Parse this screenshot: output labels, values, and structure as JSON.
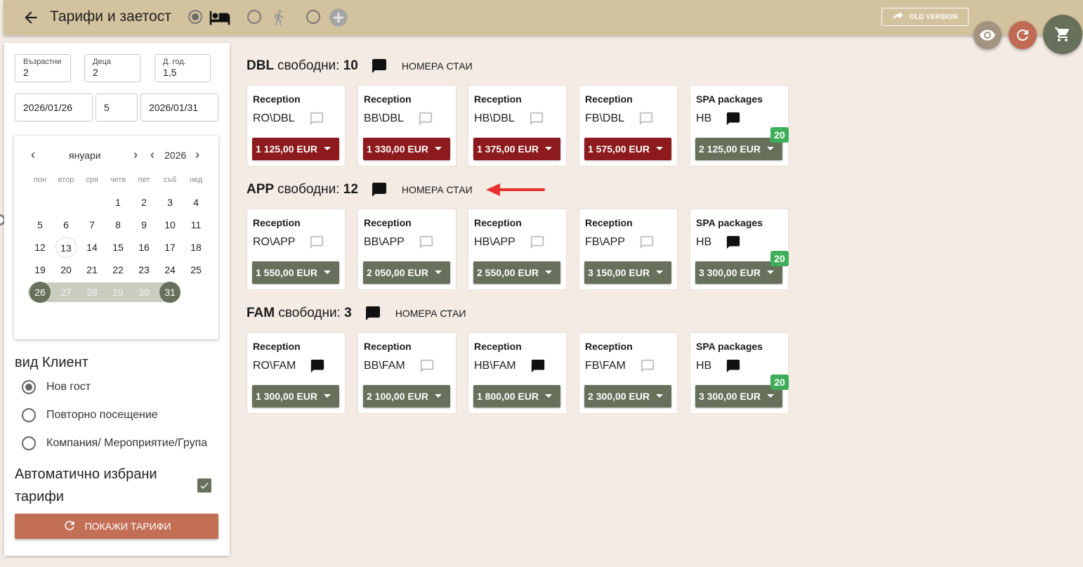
{
  "header": {
    "title": "Тарифи и заетост",
    "old_version_label": "OLD VERSION",
    "mode_options": [
      {
        "icon": "bed-icon",
        "checked": true
      },
      {
        "icon": "walking-person-icon",
        "checked": false
      },
      {
        "icon": "add-circle-icon",
        "checked": false
      }
    ]
  },
  "filters": {
    "adults": {
      "label": "Възрастни",
      "value": "2"
    },
    "children": {
      "label": "Деца",
      "value": "2"
    },
    "child_age": {
      "label": "Д. год.",
      "value": "1,5"
    },
    "date_from": "2026/01/26",
    "nights": "5",
    "date_to": "2026/01/31"
  },
  "calendar": {
    "prev": "‹",
    "month": "януари",
    "next": "›",
    "year_prev": "‹",
    "year": "2026",
    "year_next": "›",
    "weekdays": [
      "пон",
      "втор",
      "сря",
      "четв",
      "пет",
      "съб",
      "нед"
    ],
    "weeks": [
      [
        "",
        "",
        "",
        "1",
        "2",
        "3",
        "4"
      ],
      [
        "5",
        "6",
        "7",
        "8",
        "9",
        "10",
        "11"
      ],
      [
        "12",
        "13",
        "14",
        "15",
        "16",
        "17",
        "18"
      ],
      [
        "19",
        "20",
        "21",
        "22",
        "23",
        "24",
        "25"
      ],
      [
        "26",
        "27",
        "28",
        "29",
        "30",
        "31",
        ""
      ]
    ],
    "today": "13",
    "range_start": "26",
    "range_end": "31"
  },
  "client": {
    "title": "вид Клиент",
    "options": [
      {
        "label": "Нов гост",
        "checked": true
      },
      {
        "label": "Повторно посещение",
        "checked": false
      },
      {
        "label": "Компания/ Мероприятие/Група",
        "checked": false
      }
    ]
  },
  "auto_tariffs": {
    "label": "Автоматично избрани тарифи",
    "checked": true
  },
  "show_button": "ПОКАЖИ ТАРИФИ",
  "rooms_label": "НОМЕРА СТАИ",
  "sections": [
    {
      "code": "DBL",
      "free_label": "свободни:",
      "free_count": "10",
      "cards": [
        {
          "title": "Reception",
          "code": "RO\\DBL",
          "note_filled": false,
          "price": "1 125,00 EUR",
          "style": "red",
          "badge": ""
        },
        {
          "title": "Reception",
          "code": "BB\\DBL",
          "note_filled": false,
          "price": "1 330,00 EUR",
          "style": "red",
          "badge": ""
        },
        {
          "title": "Reception",
          "code": "HB\\DBL",
          "note_filled": false,
          "price": "1 375,00 EUR",
          "style": "red",
          "badge": ""
        },
        {
          "title": "Reception",
          "code": "FB\\DBL",
          "note_filled": false,
          "price": "1 575,00 EUR",
          "style": "red",
          "badge": ""
        },
        {
          "title": "SPA packages",
          "code": "HB",
          "note_filled": true,
          "price": "2 125,00 EUR",
          "style": "green",
          "badge": "20"
        }
      ]
    },
    {
      "code": "APP",
      "free_label": "свободни:",
      "free_count": "12",
      "cards": [
        {
          "title": "Reception",
          "code": "RO\\APP",
          "note_filled": false,
          "price": "1 550,00 EUR",
          "style": "green",
          "badge": ""
        },
        {
          "title": "Reception",
          "code": "BB\\APP",
          "note_filled": false,
          "price": "2 050,00 EUR",
          "style": "green",
          "badge": ""
        },
        {
          "title": "Reception",
          "code": "HB\\APP",
          "note_filled": false,
          "price": "2 550,00 EUR",
          "style": "green",
          "badge": ""
        },
        {
          "title": "Reception",
          "code": "FB\\APP",
          "note_filled": false,
          "price": "3 150,00 EUR",
          "style": "green",
          "badge": ""
        },
        {
          "title": "SPA packages",
          "code": "HB",
          "note_filled": true,
          "price": "3 300,00 EUR",
          "style": "green",
          "badge": "20"
        }
      ]
    },
    {
      "code": "FAM",
      "free_label": "свободни:",
      "free_count": "3",
      "cards": [
        {
          "title": "Reception",
          "code": "RO\\FAM",
          "note_filled": true,
          "price": "1 300,00 EUR",
          "style": "green",
          "badge": ""
        },
        {
          "title": "Reception",
          "code": "BB\\FAM",
          "note_filled": false,
          "price": "2 100,00 EUR",
          "style": "green",
          "badge": ""
        },
        {
          "title": "Reception",
          "code": "HB\\FAM",
          "note_filled": true,
          "price": "1 800,00 EUR",
          "style": "green",
          "badge": ""
        },
        {
          "title": "Reception",
          "code": "FB\\FAM",
          "note_filled": false,
          "price": "2 300,00 EUR",
          "style": "green",
          "badge": ""
        },
        {
          "title": "SPA packages",
          "code": "HB",
          "note_filled": true,
          "price": "3 300,00 EUR",
          "style": "green",
          "badge": "20"
        }
      ]
    }
  ],
  "colors": {
    "header_bg": "#d3c29e",
    "price_red": "#8d1a1c",
    "price_green": "#67705a",
    "badge_green": "#3fae5a",
    "button_accent": "#c36f56",
    "annotation_arrow": "#e8302e"
  }
}
